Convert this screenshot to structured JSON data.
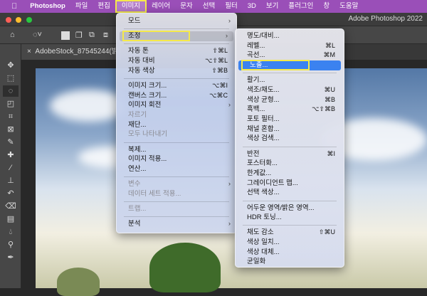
{
  "menubar": {
    "apple": "",
    "app": "Photoshop",
    "items": [
      "파일",
      "편집",
      "이미지",
      "레이어",
      "문자",
      "선택",
      "필터",
      "3D",
      "보기",
      "플러그인",
      "창",
      "도움말"
    ],
    "active": "이미지"
  },
  "window": {
    "title": "Adobe Photoshop 2022"
  },
  "document_tab": {
    "close": "×",
    "name": "AdobeStock_87545244(밝"
  },
  "colors": {
    "menubar": "#9a4fb8",
    "highlight": "#3b82f0",
    "outline": "#f5e94a"
  },
  "image_menu": {
    "mode": "모드",
    "adjust": "조정",
    "auto_tone": {
      "label": "자동 톤",
      "shortcut": "⇧⌘L"
    },
    "auto_contrast": {
      "label": "자동 대비",
      "shortcut": "⌥⇧⌘L"
    },
    "auto_color": {
      "label": "자동 색상",
      "shortcut": "⇧⌘B"
    },
    "image_size": {
      "label": "이미지 크기...",
      "shortcut": "⌥⌘I"
    },
    "canvas_size": {
      "label": "캔버스 크기...",
      "shortcut": "⌥⌘C"
    },
    "rotate": "이미지 회전",
    "crop": "자르기",
    "trim": "재단...",
    "reveal_all": "모두 나타내기",
    "duplicate": "복제...",
    "apply_image": "이미지 적용...",
    "calculations": "연산...",
    "variables": "변수",
    "apply_data_set": "데이터 세트 적용...",
    "trap": "트랩...",
    "analysis": "분석"
  },
  "adjust_menu": [
    {
      "label": "명도/대비..."
    },
    {
      "label": "레벨...",
      "shortcut": "⌘L"
    },
    {
      "label": "곡선...",
      "shortcut": "⌘M"
    },
    {
      "label": "노출..."
    },
    {
      "label": "활기..."
    },
    {
      "label": "색조/채도...",
      "shortcut": "⌘U"
    },
    {
      "label": "색상 균형...",
      "shortcut": "⌘B"
    },
    {
      "label": "흑백...",
      "shortcut": "⌥⇧⌘B"
    },
    {
      "label": "포토 필터..."
    },
    {
      "label": "채널 혼합..."
    },
    {
      "label": "색상 검색..."
    },
    {
      "label": "반전",
      "shortcut": "⌘I"
    },
    {
      "label": "포스터화..."
    },
    {
      "label": "한계값..."
    },
    {
      "label": "그레이디언트 맵..."
    },
    {
      "label": "선택 색상..."
    },
    {
      "label": "어두운 영역/밝은 영역..."
    },
    {
      "label": "HDR 토닝..."
    },
    {
      "label": "채도 감소",
      "shortcut": "⇧⌘U"
    },
    {
      "label": "색상 일치..."
    },
    {
      "label": "색상 대체..."
    },
    {
      "label": "균일화"
    }
  ]
}
